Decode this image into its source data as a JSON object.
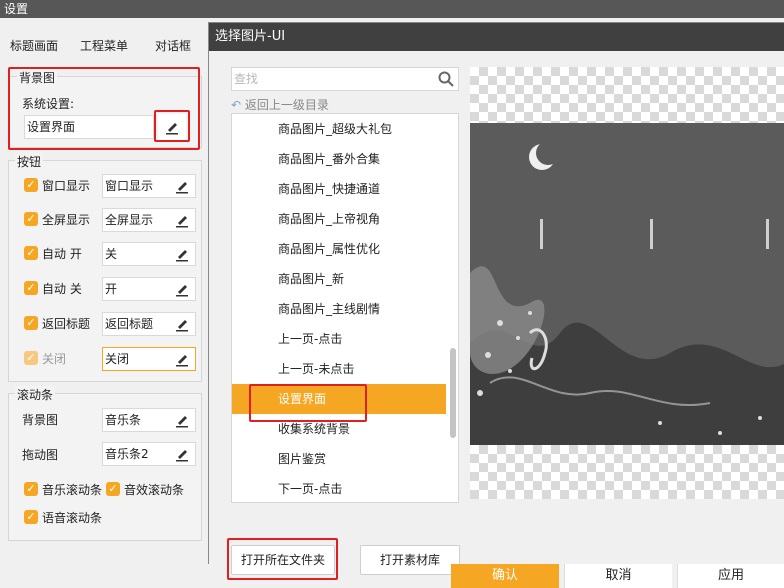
{
  "window": {
    "title": "设置"
  },
  "tabs": [
    "标题画面",
    "工程菜单",
    "对话框"
  ],
  "background": {
    "group_label": "背景图",
    "system_label": "系统设置:",
    "system_value": "设置界面"
  },
  "buttons": {
    "group_label": "按钮",
    "rows": [
      {
        "label": "窗口显示",
        "value": "窗口显示"
      },
      {
        "label": "全屏显示",
        "value": "全屏显示"
      },
      {
        "label": "自动 开",
        "value": "关"
      },
      {
        "label": "自动 关",
        "value": "开"
      },
      {
        "label": "返回标题",
        "value": "返回标题"
      },
      {
        "label": "关闭",
        "value": "关闭"
      }
    ]
  },
  "scrollbar_group": {
    "group_label": "滚动条",
    "bg_label": "背景图",
    "bg_value": "音乐条",
    "drag_label": "拖动图",
    "drag_value": "音乐条2",
    "checks": [
      "音乐滚动条",
      "音效滚动条",
      "语音滚动条"
    ]
  },
  "dialog": {
    "title": "选择图片-UI",
    "search_placeholder": "查找",
    "back_label": "返回上一级目录",
    "items": [
      "商品图片_超级大礼包",
      "商品图片_番外合集",
      "商品图片_快捷通道",
      "商品图片_上帝视角",
      "商品图片_属性优化",
      "商品图片_新",
      "商品图片_主线剧情",
      "上一页-点击",
      "上一页-未点击",
      "设置界面",
      "收集系统背景",
      "图片鉴赏",
      "下一页-点击"
    ],
    "selected_index": 9,
    "open_folder_label": "打开所在文件夹",
    "open_library_label": "打开素材库"
  },
  "footer": {
    "confirm": "确认",
    "cancel": "取消",
    "apply": "应用"
  },
  "colors": {
    "accent": "#f5a623",
    "highlight_box": "#e02020",
    "title_bar": "#404040"
  }
}
